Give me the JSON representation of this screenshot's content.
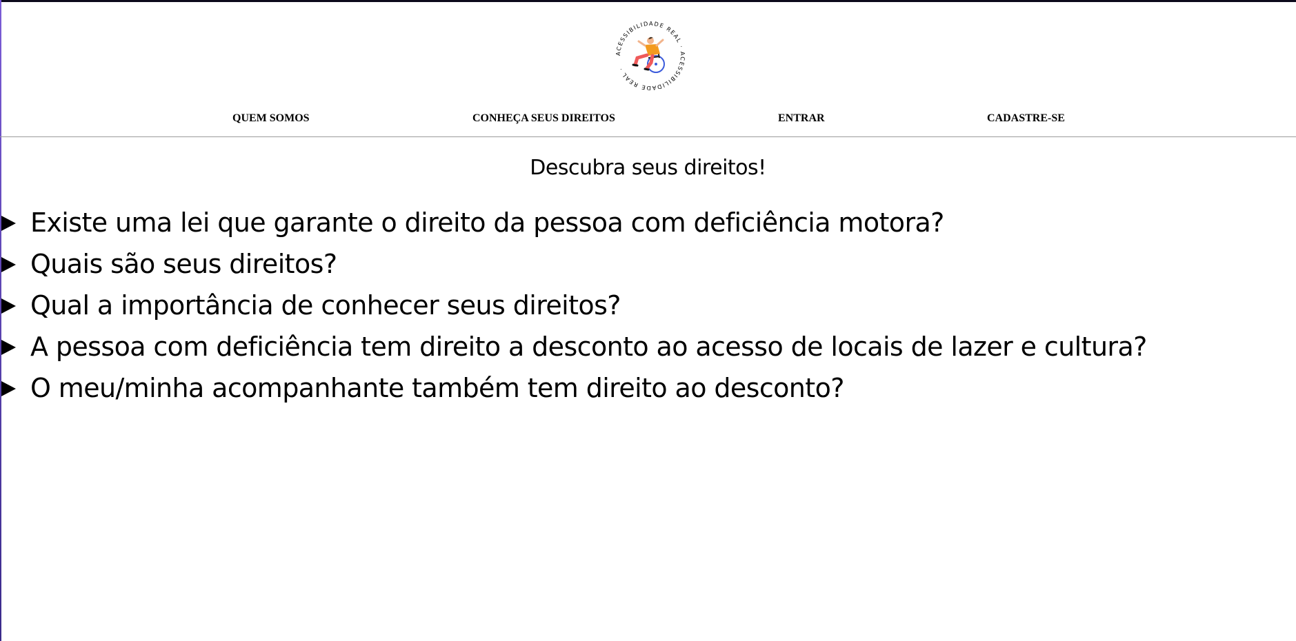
{
  "logo": {
    "ring_text": "ACESSIBILIDADE REAL · ACESSIBILIDADE REAL ·",
    "colors": {
      "ring": "#000000",
      "shirt": "#f39a1e",
      "pants": "#ef5a5a",
      "wheel": "#3b5bdb",
      "skin": "#f2b48c"
    }
  },
  "nav": {
    "items": [
      {
        "label": "QUEM SOMOS"
      },
      {
        "label": "CONHEÇA SEUS DIREITOS"
      },
      {
        "label": "ENTRAR"
      },
      {
        "label": "CADASTRE-SE"
      }
    ]
  },
  "main": {
    "title": "Descubra seus direitos!",
    "questions": [
      "Existe uma lei que garante o direito da pessoa com deficiência motora?",
      "Quais são seus direitos?",
      "Qual a importância de conhecer seus direitos?",
      "A pessoa com deficiência tem direito a desconto ao acesso de locais de lazer e cultura?",
      "O meu/minha acompanhante também tem direito ao desconto?"
    ]
  },
  "icons": {
    "logo": "wheelchair-user-logo",
    "expand": "triangle-right-icon"
  }
}
